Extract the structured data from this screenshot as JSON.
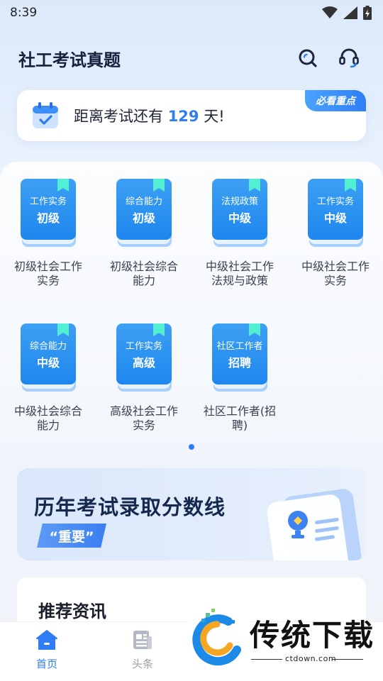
{
  "status_bar": {
    "time": "8:39"
  },
  "header": {
    "title": "社工考试真题",
    "search_icon": "search-icon",
    "service_icon": "headset-icon"
  },
  "countdown": {
    "prefix": "距离考试还有",
    "days": "129",
    "suffix": "天!",
    "badge": "必看重点",
    "icon": "calendar-check-icon"
  },
  "books": [
    {
      "line1": "工作实务",
      "line2": "初级",
      "caption": "初级社会工作实务"
    },
    {
      "line1": "综合能力",
      "line2": "初级",
      "caption": "初级社会综合能力"
    },
    {
      "line1": "法规政策",
      "line2": "中级",
      "caption": "中级社会工作法规与政策"
    },
    {
      "line1": "工作实务",
      "line2": "中级",
      "caption": "中级社会工作实务"
    },
    {
      "line1": "综合能力",
      "line2": "中级",
      "caption": "中级社会综合能力"
    },
    {
      "line1": "工作实务",
      "line2": "高级",
      "caption": "高级社会工作实务"
    },
    {
      "line1": "社区工作者",
      "line2": "招聘",
      "caption": "社区工作者(招聘)"
    }
  ],
  "score_banner": {
    "title": "历年考试录取分数线",
    "badge": "“重要”"
  },
  "news": {
    "title": "推荐资讯"
  },
  "bottom_nav": [
    {
      "label": "首页",
      "icon": "home-icon",
      "active": true
    },
    {
      "label": "头条",
      "icon": "news-icon",
      "active": false
    }
  ],
  "watermark": {
    "text": "传统下载",
    "url": "ctdown.com"
  },
  "colors": {
    "accent": "#2f7df6",
    "book_blue": "#1e86ee",
    "ribbon": "#52f0d2"
  }
}
